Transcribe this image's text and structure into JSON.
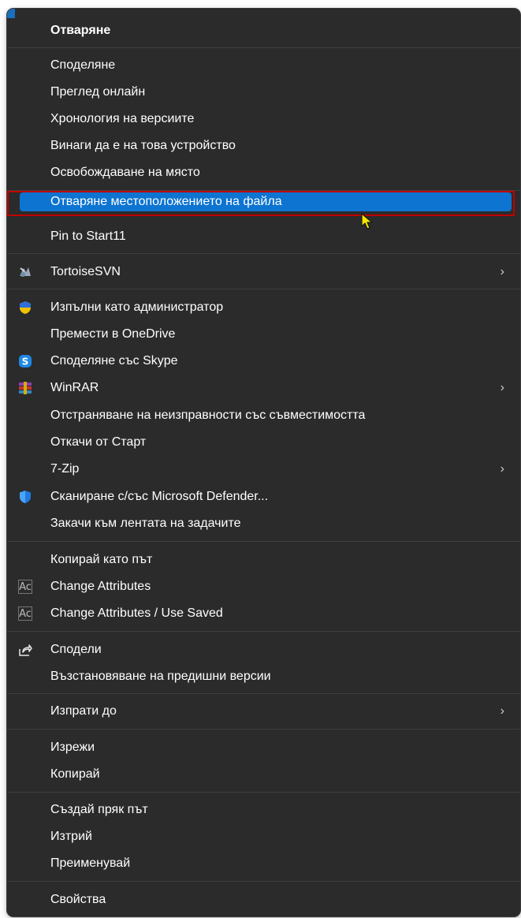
{
  "menu": {
    "items": [
      {
        "label": "Отваряне",
        "bold": true
      },
      {
        "label": "Споделяне"
      },
      {
        "label": "Преглед онлайн"
      },
      {
        "label": "Хронология на версиите"
      },
      {
        "label": "Винаги да е на това устройство"
      },
      {
        "label": "Освобождаване на място"
      },
      {
        "label": "Отваряне местоположението на файла",
        "selected": true
      },
      {
        "label": "Pin to Start11"
      },
      {
        "label": "TortoiseSVN",
        "icon": "tortoisesvn-icon",
        "submenu": true
      },
      {
        "label": "Изпълни като администратор",
        "icon": "uac-shield-icon"
      },
      {
        "label": "Премести в OneDrive"
      },
      {
        "label": "Споделяне със Skype",
        "icon": "skype-icon"
      },
      {
        "label": "WinRAR",
        "icon": "winrar-icon",
        "submenu": true
      },
      {
        "label": "Отстраняване на неизправности със съвместимостта"
      },
      {
        "label": "Откачи от Старт"
      },
      {
        "label": "7-Zip",
        "submenu": true
      },
      {
        "label": "Сканиране с/със Microsoft Defender...",
        "icon": "defender-shield-icon"
      },
      {
        "label": "Закачи към лентата на задачите"
      },
      {
        "label": "Копирай като път"
      },
      {
        "label": "Change Attributes",
        "icon": "attributes-icon"
      },
      {
        "label": "Change Attributes / Use Saved",
        "icon": "attributes-icon"
      },
      {
        "label": "Сподели",
        "icon": "share-icon"
      },
      {
        "label": "Възстановяване на предишни версии"
      },
      {
        "label": "Изпрати до",
        "submenu": true
      },
      {
        "label": "Изрежи"
      },
      {
        "label": "Копирай"
      },
      {
        "label": "Създай пряк път"
      },
      {
        "label": "Изтрий"
      },
      {
        "label": "Преименувай"
      },
      {
        "label": "Свойства"
      }
    ],
    "chevron": "›",
    "attributes_icon_text": "Ac"
  },
  "colors": {
    "background": "#2b2b2b",
    "text": "#ffffff",
    "selection": "#0d74d1",
    "annotation_border": "#c00000",
    "separator": "#3e3e3e"
  }
}
